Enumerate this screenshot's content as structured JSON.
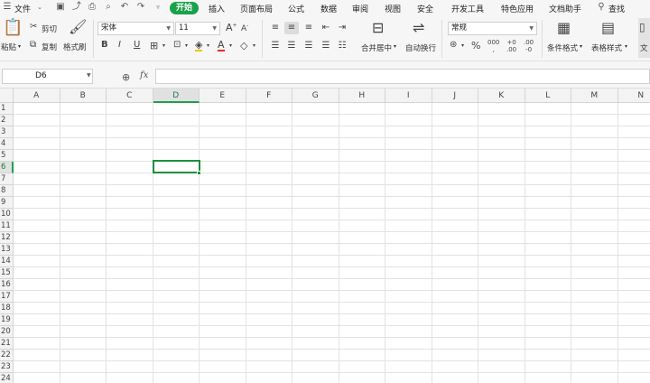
{
  "menubar": {
    "file": "文件",
    "tabs": [
      "开始",
      "插入",
      "页面布局",
      "公式",
      "数据",
      "审阅",
      "视图",
      "安全",
      "开发工具",
      "特色应用",
      "文档助手"
    ],
    "search": "查找"
  },
  "ribbon": {
    "paste": "粘贴",
    "cut": "剪切",
    "copy": "复制",
    "format_painter": "格式刷",
    "font_name": "宋体",
    "font_size": "11",
    "bold": "B",
    "italic": "I",
    "underline": "U",
    "merge_center": "合并居中",
    "wrap_text": "自动换行",
    "number_format": "常规",
    "conditional_format": "条件格式",
    "table_style": "表格样式",
    "more": "文"
  },
  "formula_bar": {
    "cell_ref": "D6",
    "fx": "fx",
    "formula": ""
  },
  "sheet": {
    "columns": [
      "A",
      "B",
      "C",
      "D",
      "E",
      "F",
      "G",
      "H",
      "I",
      "J",
      "K",
      "L",
      "M",
      "N"
    ],
    "rows": [
      "1",
      "2",
      "3",
      "4",
      "5",
      "6",
      "7",
      "8",
      "9",
      "10",
      "11",
      "12",
      "13",
      "14",
      "15",
      "16",
      "17",
      "18",
      "19",
      "20",
      "21",
      "22",
      "23",
      "24"
    ],
    "selected_column": "D",
    "selected_row": "6"
  },
  "colors": {
    "accent": "#1aa24a",
    "selection": "#1e8e3e"
  }
}
